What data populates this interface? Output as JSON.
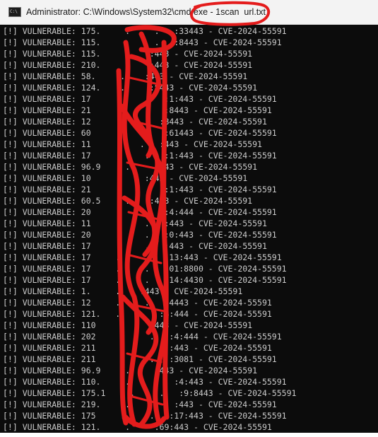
{
  "window": {
    "title": "Administrator: C:\\Windows\\System32\\cmd.exe - 1scan  url.txt",
    "icon": "cmd-console-icon",
    "icon_text": "C:\\"
  },
  "console": {
    "lines": [
      "[!] VULNERABLE: 175.     .     .   :33443 - CVE-2024-55591",
      "[!] VULNERABLE: 115.     .     .   :8443 - CVE-2024-55591",
      "[!] VULNERABLE: 115.     .    :443 - CVE-2024-55591",
      "[!] VULNERABLE: 210.     .    :443 - CVE-2024-55591",
      "[!] VULNERABLE: 58.     .    :443 - CVE-2024-55591",
      "[!] VULNERABLE: 124.    .     :8443 - CVE-2024-55591",
      "[!] VULNERABLE: 17     .     .   :1:443 - CVE-2024-55591",
      "[!] VULNERABLE: 21     .     .   :8443 - CVE-2024-55591",
      "[!] VULNERABLE: 12     .    .   :8443 - CVE-2024-55591",
      "[!] VULNERABLE: 60     .     .   :61443 - CVE-2024-55591",
      "[!] VULNERABLE: 11     .    .   :443 - CVE-2024-55591",
      "[!] VULNERABLE: 17     .     .   :1:443 - CVE-2024-55591",
      "[!] VULNERABLE: 96.9     .     :443 - CVE-2024-55591",
      "[!] VULNERABLE: 10     .     :443 - CVE-2024-55591",
      "[!] VULNERABLE: 21     .     .   :1:443 - CVE-2024-55591",
      "[!] VULNERABLE: 60.5     .    :443 - CVE-2024-55591",
      "[!] VULNERABLE: 20     .     .   :4:444 - CVE-2024-55591",
      "[!] VULNERABLE: 11     .     .   :443 - CVE-2024-55591",
      "[!] VULNERABLE: 20     .     .   :0:443 - CVE-2024-55591",
      "[!] VULNERABLE: 17     .     .   :443 - CVE-2024-55591",
      "[!] VULNERABLE: 17     .     .   :13:443 - CVE-2024-55591",
      "[!] VULNERABLE: 17     .     .   :01:8800 - CVE-2024-55591",
      "[!] VULNERABLE: 17     .     .   :14:4430 - CVE-2024-55591",
      "[!] VULNERABLE: 1.     .    :443 - CVE-2024-55591",
      "[!] VULNERABLE: 12     .     .   :4443 - CVE-2024-55591",
      "[!] VULNERABLE: 121.   .    .   :4:444 - CVE-2024-55591",
      "[!] VULNERABLE: 110     .     :443 - CVE-2024-55591",
      "[!] VULNERABLE: 202     .     .   :4:444 - CVE-2024-55591",
      "[!] VULNERABLE: 211     .     .   :443 - CVE-2024-55591",
      "[!] VULNERABLE: 211     .     .   :3081 - CVE-2024-55591",
      "[!] VULNERABLE: 96.9     .     :443 - CVE-2024-55591",
      "[!] VULNERABLE: 110.     .     .   :4:443 - CVE-2024-55591",
      "[!] VULNERABLE: 175.1     .     .   :9:8443 - CVE-2024-55591",
      "[!] VULNERABLE: 219.     .     .   :443 - CVE-2024-55591",
      "[!] VULNERABLE: 175     .     .   :17:443 - CVE-2024-55591",
      "[!] VULNERABLE: 121.     .     :69:443 - CVE-2024-55591"
    ]
  },
  "colors": {
    "console_bg": "#0c0c0c",
    "console_text": "#cccccc",
    "titlebar_bg": "#f3f3f3",
    "redaction": "#e41c1c"
  }
}
